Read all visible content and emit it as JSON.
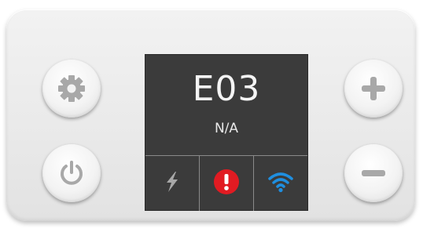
{
  "display": {
    "code": "E03",
    "status_text": "N/A"
  },
  "controls": {
    "left": [
      "gear-icon",
      "power-icon"
    ],
    "right": [
      "plus-icon",
      "minus-icon"
    ]
  },
  "status_icons": [
    "lightning-icon",
    "warning-icon",
    "wifi-icon"
  ],
  "colors": {
    "display_bg": "#3b3b3b",
    "icon_gray": "#a8a8a8",
    "warning_red": "#e11b22",
    "wifi_blue": "#1f8fe0"
  }
}
